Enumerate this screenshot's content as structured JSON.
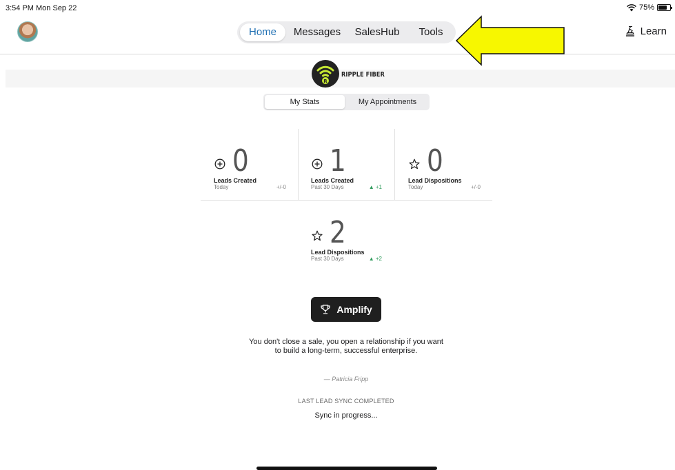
{
  "status_bar": {
    "time": "3:54 PM  Mon Sep 22",
    "battery": "75%",
    "battery_level": 0.75
  },
  "header": {
    "tabs": [
      {
        "label": "Home",
        "active": true
      },
      {
        "label": "Messages",
        "active": false
      },
      {
        "label": "SalesHub",
        "active": false
      },
      {
        "label": "Tools",
        "active": false
      }
    ],
    "learn_label": "Learn"
  },
  "brand": {
    "name": "RIPPLE FIBER",
    "logo_icon": "ripple-fiber-logo-icon",
    "accent": "#c6e833"
  },
  "segments": {
    "items": [
      {
        "label": "My Stats",
        "active": true
      },
      {
        "label": "My Appointments",
        "active": false
      }
    ]
  },
  "stats": [
    {
      "icon": "plus-circle-icon",
      "value": "0",
      "label": "Leads Created",
      "period": "Today",
      "delta": "+/-0",
      "trend": "flat"
    },
    {
      "icon": "plus-circle-icon",
      "value": "1",
      "label": "Leads Created",
      "period": "Past 30 Days",
      "delta": "▲ +1",
      "trend": "up"
    },
    {
      "icon": "star-icon",
      "value": "0",
      "label": "Lead Dispositions",
      "period": "Today",
      "delta": "+/-0",
      "trend": "flat"
    },
    {
      "icon": "star-icon",
      "value": "2",
      "label": "Lead Dispositions",
      "period": "Past 30 Days",
      "delta": "▲ +2",
      "trend": "up"
    }
  ],
  "amplify": {
    "label": "Amplify",
    "icon": "trophy-icon"
  },
  "quote": {
    "text": "You don't close a sale, you open a relationship if you want to build a long-term, successful enterprise.",
    "author": "— Patricia Fripp"
  },
  "sync": {
    "title": "LAST LEAD SYNC COMPLETED",
    "status": "Sync in progress..."
  },
  "colors": {
    "active_tab": "#1e6fb3",
    "positive_delta": "#2e9b5b",
    "annotation": "#f7f700"
  }
}
